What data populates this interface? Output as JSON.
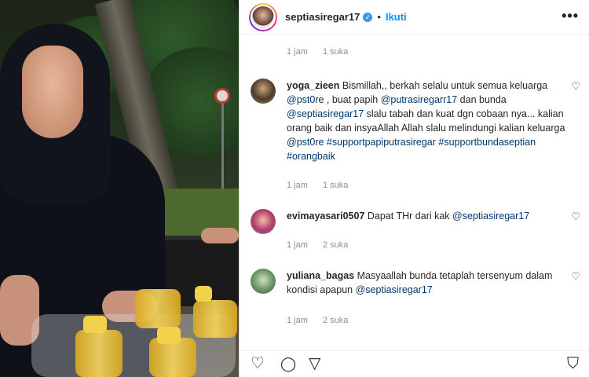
{
  "post": {
    "username": "septiasiregar17",
    "follow_label": "Ikuti",
    "more_label": "•••"
  },
  "top_meta": {
    "time": "1 jam",
    "likes": "1 suka"
  },
  "comments": [
    {
      "username": "yoga_zieen",
      "text_parts": [
        {
          "t": "Bismillah,, berkah selalu untuk semua keluarga "
        },
        {
          "t": "@pst0re",
          "m": true
        },
        {
          "t": " , buat papih "
        },
        {
          "t": "@putrasiregarr17",
          "m": true
        },
        {
          "t": " dan bunda "
        },
        {
          "t": "@septiasiregar17",
          "m": true
        },
        {
          "t": " slalu tabah dan kuat dgn cobaan nya... kalian orang baik dan insyaAllah Allah slalu melindungi kalian keluarga "
        },
        {
          "t": "@pst0re",
          "m": true
        },
        {
          "t": " "
        },
        {
          "t": "#supportpapiputrasiregar",
          "m": true
        },
        {
          "t": " "
        },
        {
          "t": "#supportbundaseptian",
          "m": true
        },
        {
          "t": " "
        },
        {
          "t": "#orangbaik",
          "m": true
        }
      ],
      "time": "1 jam",
      "likes": "1 suka"
    },
    {
      "username": "evimayasari0507",
      "text_parts": [
        {
          "t": "Dapat THr dari kak "
        },
        {
          "t": "@septiasiregar17",
          "m": true
        }
      ],
      "time": "1 jam",
      "likes": "2 suka"
    },
    {
      "username": "yuliana_bagas",
      "text_parts": [
        {
          "t": "Masyaallah bunda tetaplah tersenyum dalam kondisi apapun "
        },
        {
          "t": "@septiasiregar17",
          "m": true
        }
      ],
      "time": "1 jam",
      "likes": "2 suka"
    }
  ],
  "icons": {
    "heart": "♡",
    "comment": "◯",
    "share": "▽",
    "bookmark": "⛉"
  }
}
